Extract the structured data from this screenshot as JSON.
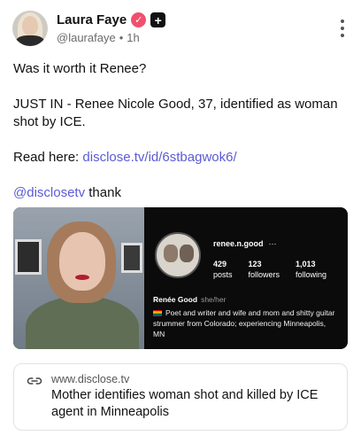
{
  "author": {
    "display_name": "Laura Faye",
    "handle": "@laurafaye",
    "separator": "•",
    "time": "1h"
  },
  "icons": {
    "verified": "verified-check-icon",
    "plus": "plus-icon",
    "more": "more-vertical-icon",
    "link": "link-icon"
  },
  "colors": {
    "link": "#5b5bd6",
    "verified": "#f0506e"
  },
  "post": {
    "line1": "Was it worth it Renee?",
    "line2": "JUST IN - Renee Nicole Good, 37, identified as woman shot by ICE.",
    "read_prefix": "Read here: ",
    "read_link": "disclose.tv/id/6stbagwok6/",
    "mention": "@disclosetv",
    "mention_suffix": " thank"
  },
  "profile_card": {
    "username": "renee.n.good",
    "username_more": "···",
    "posts_count": "429",
    "posts_label": "posts",
    "followers_count": "123",
    "followers_label": "followers",
    "following_count": "1,013",
    "following_label": "following",
    "name": "Renée Good",
    "pronouns": "she/her",
    "bio": "Poet and writer and wife and mom and shitty guitar strummer from Colorado; experiencing Minneapolis, MN"
  },
  "link_card": {
    "domain": "www.disclose.tv",
    "title": "Mother identifies woman shot and killed by ICE agent in Minneapolis"
  }
}
